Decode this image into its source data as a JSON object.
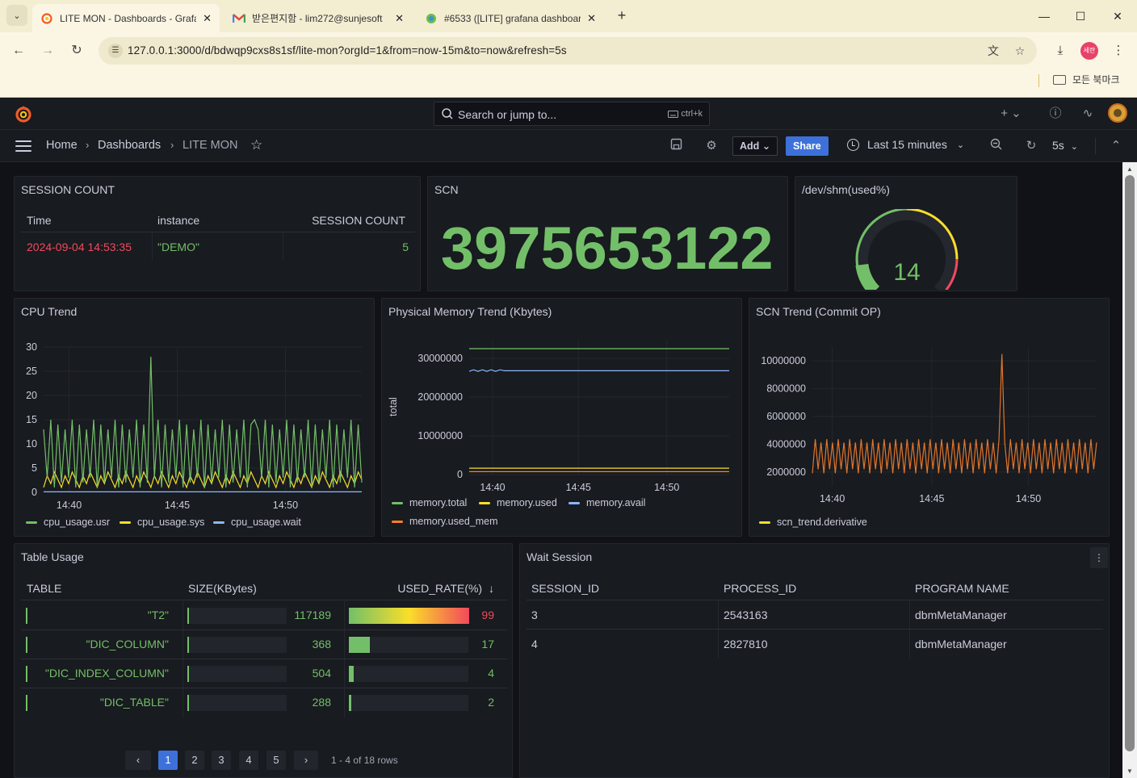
{
  "browser": {
    "tabs": [
      {
        "title": "LITE MON - Dashboards - Grafana",
        "active": true,
        "icon": "grafana-icon"
      },
      {
        "title": "받은편지함 - lim272@sunjesoft",
        "active": false,
        "icon": "gmail-icon"
      },
      {
        "title": "#6533 ([LITE] grafana dashboard",
        "active": false,
        "icon": "redmine-icon"
      }
    ],
    "url": "127.0.0.1:3000/d/bdwqp9cxs8s1sf/lite-mon?orgId=1&from=now-15m&to=now&refresh=5s",
    "profile_label": "세란",
    "bookmark_folder": "모든 북마크"
  },
  "grafana": {
    "search_placeholder": "Search or jump to...",
    "search_shortcut": "ctrl+k",
    "breadcrumbs": [
      "Home",
      "Dashboards",
      "LITE MON"
    ],
    "add_label": "Add",
    "share_label": "Share",
    "time_range": "Last 15 minutes",
    "refresh_interval": "5s"
  },
  "panels": {
    "session_count": {
      "title": "SESSION COUNT",
      "columns": [
        "Time",
        "instance",
        "SESSION COUNT"
      ],
      "rows": [
        [
          "2024-09-04 14:53:35",
          "\"DEMO\"",
          "5"
        ]
      ]
    },
    "scn": {
      "title": "SCN",
      "value": "3975653122"
    },
    "shm": {
      "title": "/dev/shm(used%)",
      "value": "14",
      "percent": 14
    },
    "cpu_trend": {
      "title": "CPU Trend",
      "y_ticks": [
        "30",
        "25",
        "20",
        "15",
        "10",
        "5",
        "0"
      ],
      "x_ticks": [
        "14:40",
        "14:45",
        "14:50"
      ],
      "legend": [
        {
          "name": "cpu_usage.usr",
          "color": "#73bf69"
        },
        {
          "name": "cpu_usage.sys",
          "color": "#fade2a"
        },
        {
          "name": "cpu_usage.wait",
          "color": "#8ab8ff"
        }
      ]
    },
    "memory_trend": {
      "title": "Physical Memory Trend (Kbytes)",
      "y_axis_label": "total",
      "y_ticks": [
        "30000000",
        "20000000",
        "10000000",
        "0"
      ],
      "x_ticks": [
        "14:40",
        "14:45",
        "14:50"
      ],
      "legend": [
        {
          "name": "memory.total",
          "color": "#73bf69"
        },
        {
          "name": "memory.used",
          "color": "#fade2a"
        },
        {
          "name": "memory.avail",
          "color": "#8ab8ff"
        },
        {
          "name": "memory.used_mem",
          "color": "#ff7f27"
        }
      ]
    },
    "scn_trend": {
      "title": "SCN Trend (Commit OP)",
      "y_ticks": [
        "10000000",
        "8000000",
        "6000000",
        "4000000",
        "2000000"
      ],
      "x_ticks": [
        "14:40",
        "14:45",
        "14:50"
      ],
      "legend": [
        {
          "name": "scn_trend.derivative",
          "color": "#fade2a"
        }
      ]
    },
    "table_usage": {
      "title": "Table Usage",
      "columns": [
        "TABLE",
        "SIZE(KBytes)",
        "USED_RATE(%)"
      ],
      "rows": [
        {
          "table": "\"T2\"",
          "size": "117189",
          "rate": "99",
          "rate_pct": 99
        },
        {
          "table": "\"DIC_COLUMN\"",
          "size": "368",
          "rate": "17",
          "rate_pct": 17
        },
        {
          "table": "\"DIC_INDEX_COLUMN\"",
          "size": "504",
          "rate": "4",
          "rate_pct": 4
        },
        {
          "table": "\"DIC_TABLE\"",
          "size": "288",
          "rate": "2",
          "rate_pct": 2
        }
      ],
      "pages": [
        "1",
        "2",
        "3",
        "4",
        "5"
      ],
      "pager_info": "1 - 4 of 18 rows"
    },
    "wait_session": {
      "title": "Wait Session",
      "columns": [
        "SESSION_ID",
        "PROCESS_ID",
        "PROGRAM NAME"
      ],
      "rows": [
        [
          "3",
          "2543163",
          "dbmMetaManager"
        ],
        [
          "4",
          "2827810",
          "dbmMetaManager"
        ]
      ]
    }
  },
  "chart_data": [
    {
      "type": "line",
      "title": "CPU Trend",
      "ylim": [
        0,
        30
      ],
      "x": [
        "14:40",
        "14:45",
        "14:50"
      ],
      "series": [
        {
          "name": "cpu_usage.usr",
          "values": [
            14,
            2,
            14,
            1,
            13,
            2,
            14,
            1,
            28,
            2,
            15,
            1,
            14,
            2,
            14,
            1,
            13,
            2,
            15,
            1,
            14
          ]
        },
        {
          "name": "cpu_usage.sys",
          "values": [
            2,
            3,
            1,
            2,
            4,
            1,
            2,
            3,
            1,
            2,
            4,
            1,
            2,
            3,
            1,
            2,
            4,
            1,
            2,
            3,
            1
          ]
        },
        {
          "name": "cpu_usage.wait",
          "values": [
            0,
            0,
            0,
            0,
            0,
            0,
            0,
            0,
            0,
            0,
            0,
            0,
            0,
            0,
            0,
            0,
            0,
            0,
            0,
            0,
            0
          ]
        }
      ]
    },
    {
      "type": "line",
      "title": "Physical Memory Trend (Kbytes)",
      "ylabel": "total",
      "ylim": [
        0,
        30000000
      ],
      "x": [
        "14:40",
        "14:45",
        "14:50"
      ],
      "series": [
        {
          "name": "memory.total",
          "values": [
            32500000,
            32500000,
            32500000
          ]
        },
        {
          "name": "memory.used",
          "values": [
            2200000,
            2200000,
            2200000
          ]
        },
        {
          "name": "memory.avail",
          "values": [
            26800000,
            26800000,
            26800000
          ]
        },
        {
          "name": "memory.used_mem",
          "values": [
            1500000,
            1500000,
            1500000
          ]
        }
      ]
    },
    {
      "type": "line",
      "title": "SCN Trend (Commit OP)",
      "ylim": [
        0,
        10000000
      ],
      "x": [
        "14:40",
        "14:45",
        "14:50"
      ],
      "series": [
        {
          "name": "scn_trend.derivative",
          "values": [
            2000000,
            4200000,
            1900000,
            4100000,
            2000000,
            4200000,
            1900000,
            4100000,
            2000000,
            10500000,
            2000000,
            4200000,
            1900000,
            4100000,
            2000000
          ]
        }
      ]
    }
  ]
}
